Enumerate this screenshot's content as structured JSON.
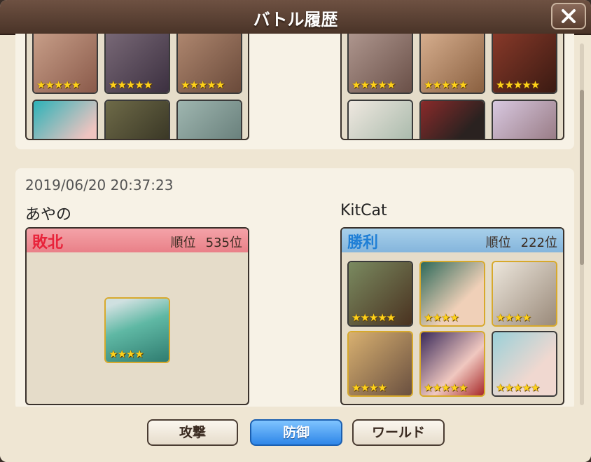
{
  "title": "バトル履歴",
  "close_label": "✕",
  "entries": [
    {
      "left_stars": [
        "★★★★★",
        "★★★★★",
        "★★★★★",
        "★★★★★",
        "★★★★★",
        "★★★★★"
      ],
      "right_stars": [
        "★★★★★",
        "★★★★★",
        "★★★★★",
        "★★★★★",
        "★★★★★",
        "★★★★★"
      ]
    },
    {
      "timestamp": "2019/06/20 20:37:23",
      "left": {
        "name": "あやの",
        "result": "敗北",
        "rank_label": "順位",
        "rank": "535位",
        "cards": [
          {
            "stars": "★★★★"
          }
        ]
      },
      "right": {
        "name": "KitCat",
        "result": "勝利",
        "rank_label": "順位",
        "rank": "222位",
        "cards": [
          {
            "stars": "★★★★★"
          },
          {
            "stars": "★★★★"
          },
          {
            "stars": "★★★★"
          },
          {
            "stars": "★★★★"
          },
          {
            "stars": "★★★★★"
          },
          {
            "stars": "★★★★★"
          }
        ]
      }
    }
  ],
  "buttons": {
    "attack": "攻撃",
    "defense": "防御",
    "world": "ワールド"
  },
  "colors": {
    "lose": "#e8233a",
    "win": "#1f7fd6",
    "star": "#ffd21a"
  }
}
